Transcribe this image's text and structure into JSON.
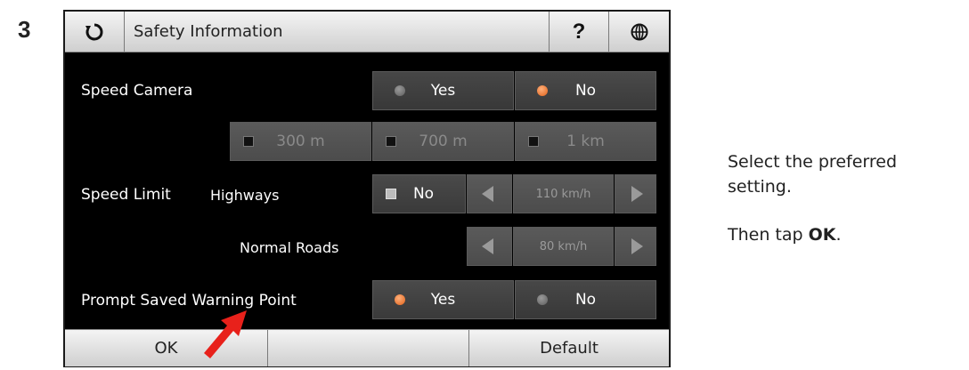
{
  "step": {
    "number": "3"
  },
  "header": {
    "title": "Safety Information",
    "back_icon": "refresh-back-icon",
    "help_label": "?",
    "globe_icon": "globe-icon"
  },
  "speed_camera": {
    "label": "Speed Camera",
    "yes_label": "Yes",
    "no_label": "No",
    "selected": "No",
    "distances": [
      "300 m",
      "700 m",
      "1 km"
    ]
  },
  "speed_limit": {
    "label": "Speed Limit",
    "highways_label": "Highways",
    "highways_toggle_label": "No",
    "highways_value": "110 km/h",
    "normal_roads_label": "Normal Roads",
    "normal_roads_value": "80 km/h"
  },
  "prompt_warning": {
    "label": "Prompt Saved Warning Point",
    "yes_label": "Yes",
    "no_label": "No",
    "selected": "Yes"
  },
  "footer": {
    "ok_label": "OK",
    "default_label": "Default"
  },
  "instructions": {
    "line1": "Select the preferred",
    "line2": "setting.",
    "line3_prefix": "Then tap ",
    "line3_bold": "OK",
    "line3_suffix": "."
  },
  "colors": {
    "accent_radio": "#e0611a",
    "pointer_arrow": "#e8211b"
  }
}
